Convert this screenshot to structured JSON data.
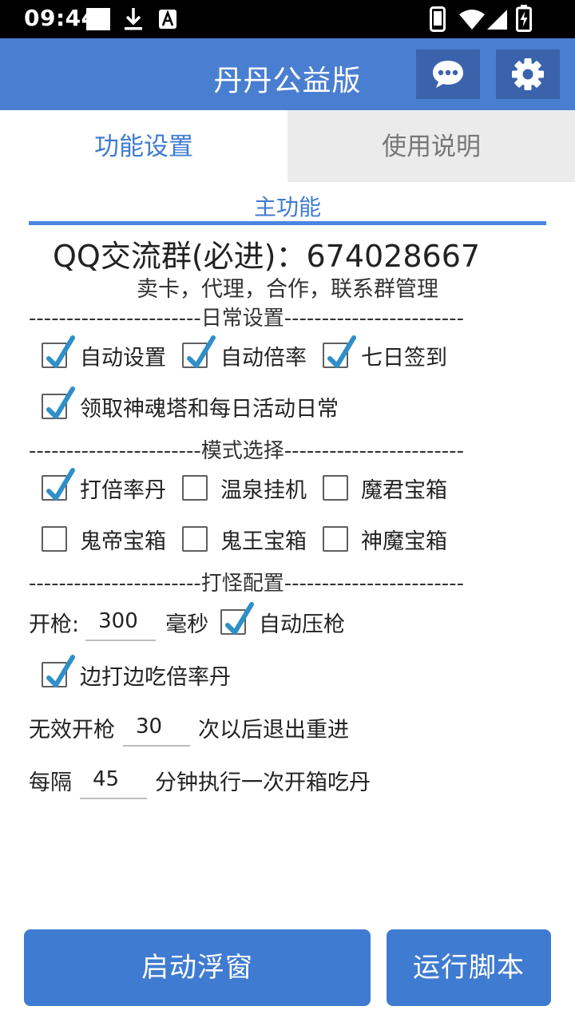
{
  "status_bar": {
    "time": "09:44",
    "icons": [
      "notification-square-icon",
      "download-icon",
      "a-badge-icon",
      "phone-icon",
      "wifi-icon",
      "signal-icon",
      "battery-charging-icon"
    ]
  },
  "app_bar": {
    "title": "丹丹公益版",
    "actions": [
      "chat-icon",
      "gear-icon"
    ],
    "accent_color": "#4a7ed0",
    "button_color": "#3a63ab"
  },
  "tabs": [
    {
      "label": "功能设置",
      "selected": true
    },
    {
      "label": "使用说明",
      "selected": false
    }
  ],
  "main": {
    "section_title": "主功能",
    "qq_group": "QQ交流群(必进)：674028667",
    "contact_line": "卖卡，代理，合作，联系群管理"
  },
  "daily": {
    "divider": "-----------------------日常设置------------------------",
    "options": [
      {
        "label": "自动设置",
        "checked": true
      },
      {
        "label": "自动倍率",
        "checked": true
      },
      {
        "label": "七日签到",
        "checked": true
      },
      {
        "label": "领取神魂塔和每日活动日常",
        "checked": true
      }
    ]
  },
  "mode": {
    "divider": "-----------------------模式选择------------------------",
    "options": [
      {
        "label": "打倍率丹",
        "checked": true
      },
      {
        "label": "温泉挂机",
        "checked": false
      },
      {
        "label": "魔君宝箱",
        "checked": false
      },
      {
        "label": "鬼帝宝箱",
        "checked": false
      },
      {
        "label": "鬼王宝箱",
        "checked": false
      },
      {
        "label": "神魔宝箱",
        "checked": false
      }
    ]
  },
  "combat": {
    "divider": "-----------------------打怪配置------------------------",
    "fire_label": "开枪:",
    "fire_value": "300",
    "fire_unit": "毫秒",
    "auto_recoil": {
      "label": "自动压枪",
      "checked": true
    },
    "eat_while_fighting": {
      "label": "边打边吃倍率丹",
      "checked": true
    },
    "invalid_prefix": "无效开枪",
    "invalid_value": "30",
    "invalid_suffix": "次以后退出重进",
    "interval_prefix": "每隔",
    "interval_value": "45",
    "interval_suffix": "分钟执行一次开箱吃丹"
  },
  "footer": {
    "float_button": "启动浮窗",
    "run_button": "运行脚本"
  },
  "colors": {
    "primary": "#3f7bd0",
    "checkbox_check": "#2e8fc9",
    "tab_inactive_bg": "#ebebeb"
  }
}
